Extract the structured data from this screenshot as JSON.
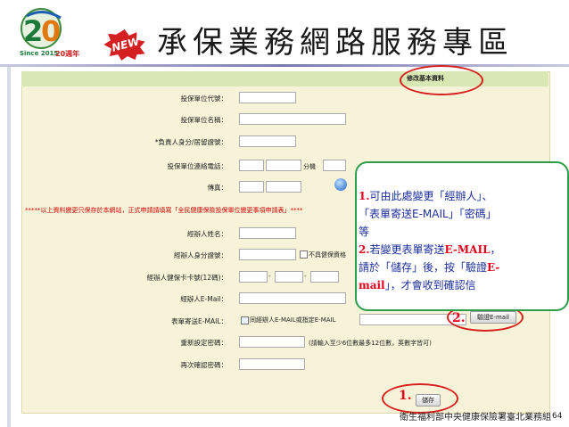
{
  "header": {
    "logo_text": "Since 2015",
    "logo_year": "20週年",
    "badge": "NEW",
    "title": "承保業務網路服務專區"
  },
  "form": {
    "section_title": "修改基本資料",
    "fields": [
      {
        "label": "投保單位代號："
      },
      {
        "label": "投保單位名稱："
      },
      {
        "label": "*負責人身分/居留證號："
      },
      {
        "label": "投保單位連絡電話："
      },
      {
        "label": "傳真："
      }
    ],
    "ext_label": "分機",
    "notice": "*****以上資料變更只保存於本網站，正式申請請填寫「全民健康保險投保單位變更事項申請表」****",
    "fields2": [
      {
        "label": "經辦人姓名："
      },
      {
        "label": "經辦人身分證號："
      },
      {
        "label": "經辦人健保卡卡號(12碼)："
      },
      {
        "label": "經辦人E-Mail："
      },
      {
        "label": "表單寄送E-MAIL："
      },
      {
        "label": "重新設定密碼："
      },
      {
        "label": "再次確認密碼："
      }
    ],
    "no_id_checkbox": "不具健保資格",
    "dash": "-",
    "same_email_checkbox": "同經辦人E-MAIL或指定E-MAIL",
    "verify_button": "驗證E-mail",
    "password_hint": "(請輸入至少6位數最多12位數，英數字皆可)",
    "save_button": "儲存"
  },
  "callout": {
    "line1_num": "1.",
    "line1_text": "可由此處變更「經辦人」、",
    "line2_text": "「表單寄送E-MAIL」「密碼」",
    "line3_text": "等",
    "line4_num": "2.",
    "line4_text": "若變更表單寄送",
    "line4_red": "E-MAIL",
    "line4_end": "，",
    "line5_text": "請於「儲存」後，按「驗證",
    "line5_red": "E-",
    "line6_red": "mail",
    "line6_text": "」，才會收到確認信"
  },
  "annotations": {
    "marker1": "1.",
    "marker2": "2."
  },
  "footer": {
    "text": "衛生福利部中央健康保險署臺北業務組",
    "page_number": "64"
  }
}
